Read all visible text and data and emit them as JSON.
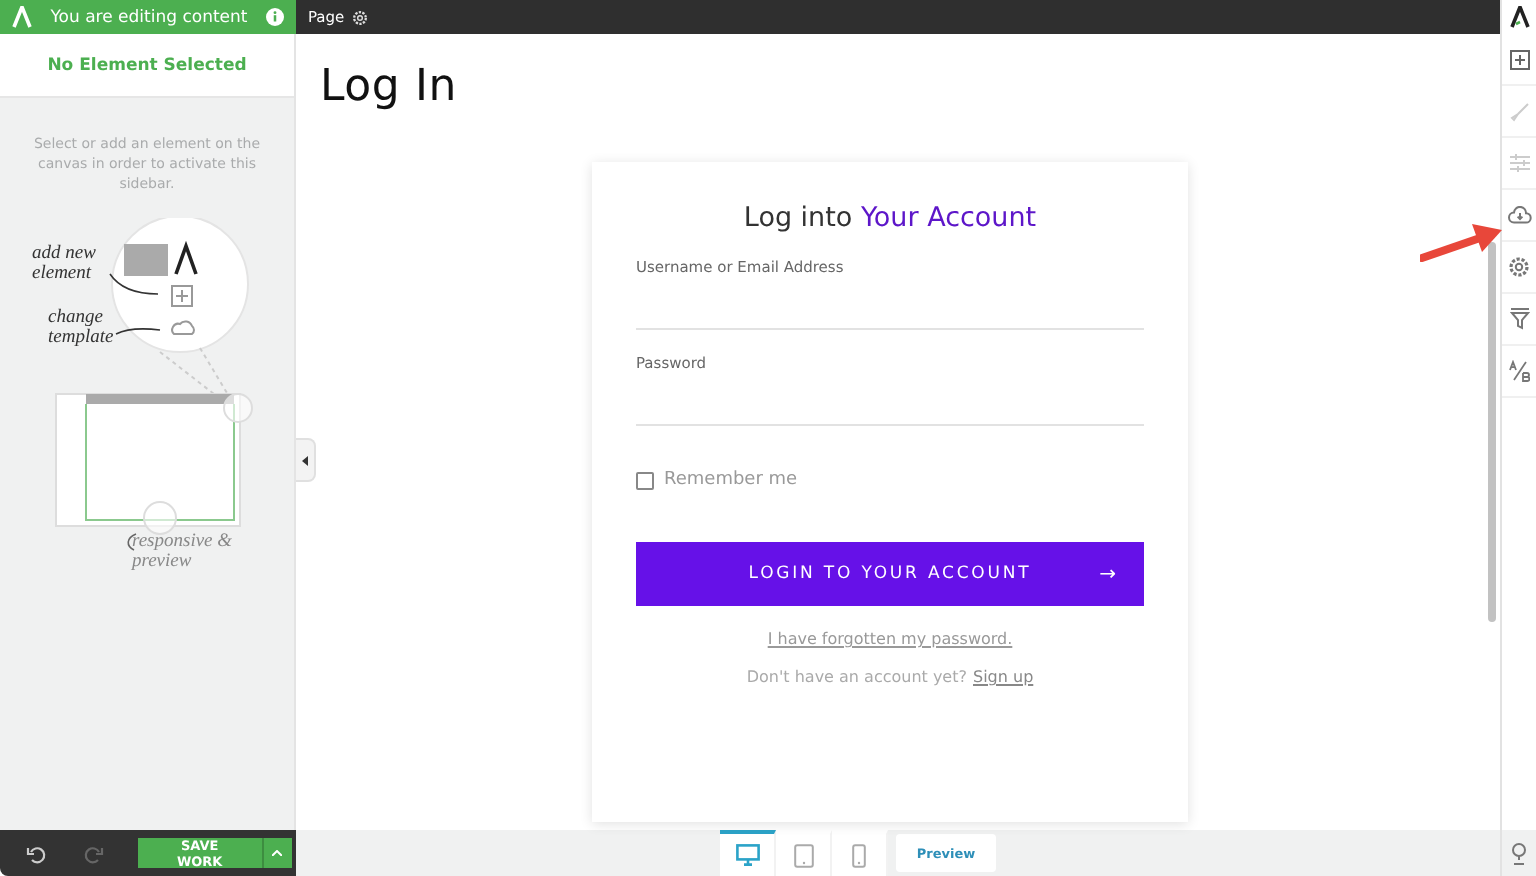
{
  "editor_banner": {
    "text": "You are editing content"
  },
  "top_bar": {
    "page_label": "Page"
  },
  "sidebar": {
    "title": "No Element Selected",
    "hint": "Select or add an element on the canvas in order to activate this sidebar.",
    "illustration_notes": [
      "add new element",
      "change template",
      "responsive & preview"
    ]
  },
  "page": {
    "heading": "Log In"
  },
  "login": {
    "title_parts": [
      {
        "kind": "plain",
        "text": "Log into"
      },
      {
        "kind": "accent",
        "text": "Your Account"
      }
    ],
    "fields": [
      {
        "label": "Username or Email Address"
      },
      {
        "label": "Password"
      }
    ],
    "remember": {
      "label": "Remember me",
      "checked": false
    },
    "button": {
      "label": "LOGIN TO YOUR ACCOUNT",
      "arrow": "→"
    },
    "forgot_link": "I have forgotten my password.",
    "signup": {
      "prompt": "Don't have an account yet?",
      "link": "Sign up"
    }
  },
  "bottom_bar": {
    "save_label": "SAVE WORK",
    "devices": [
      {
        "kind": "desktop",
        "selected": true
      },
      {
        "kind": "tablet",
        "selected": false
      },
      {
        "kind": "phone",
        "selected": false
      }
    ],
    "preview_label": "Preview"
  }
}
